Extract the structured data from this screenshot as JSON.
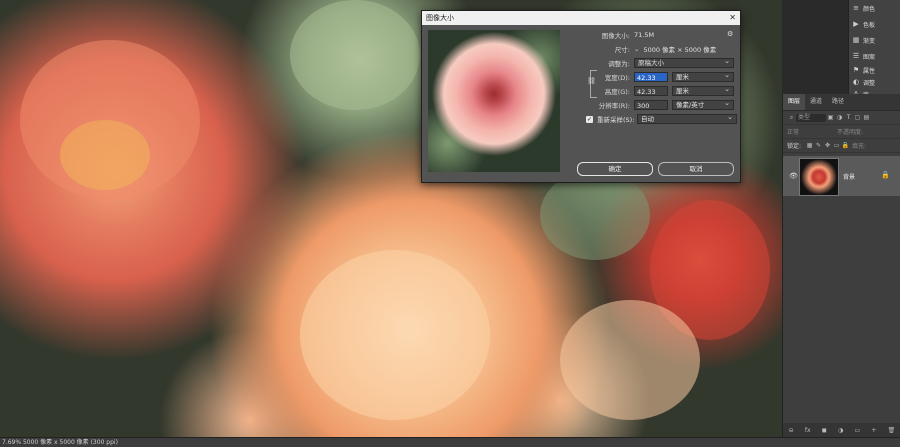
{
  "dialog": {
    "title": "图像大小",
    "image_size_label": "图像大小:",
    "image_size_value": "71.5M",
    "dimensions_label": "尺寸:",
    "dimensions_value": "5000 像素 × 5000 像素",
    "fit_to_label": "调整为:",
    "fit_to_value": "原稿大小",
    "width_label": "宽度(D):",
    "width_value": "42.33",
    "width_unit": "厘米",
    "height_label": "高度(G):",
    "height_value": "42.33",
    "height_unit": "厘米",
    "resolution_label": "分辨率(R):",
    "resolution_value": "300",
    "resolution_unit": "像素/英寸",
    "resample_label": "重新采样(S):",
    "resample_value": "自动",
    "ok_label": "确定",
    "cancel_label": "取消"
  },
  "right_toolbar": {
    "items": [
      {
        "icon": "≡",
        "label": "颜色"
      },
      {
        "icon": "▶",
        "label": "色板"
      },
      {
        "icon": "▦",
        "label": "渐变"
      },
      {
        "icon": "☰",
        "label": "图案"
      }
    ],
    "items2": [
      {
        "icon": "⚑",
        "label": "属性"
      },
      {
        "icon": "◐",
        "label": "调整"
      },
      {
        "icon": "A",
        "label": "库"
      }
    ]
  },
  "layers_panel": {
    "tabs": [
      "图层",
      "通道",
      "路径"
    ],
    "search_placeholder": "类型",
    "blend_mode": "正常",
    "opacity_label": "不透明度:",
    "lock_label": "锁定:",
    "fill_label": "填充:",
    "layer_name": "背景",
    "bottom_icons": [
      "⊖",
      "fx",
      "◼",
      "◑",
      "▭",
      "+",
      "🗑"
    ]
  },
  "status": {
    "text": "7.69% 5000 像素 x 5000 像素 (300 ppi)"
  }
}
